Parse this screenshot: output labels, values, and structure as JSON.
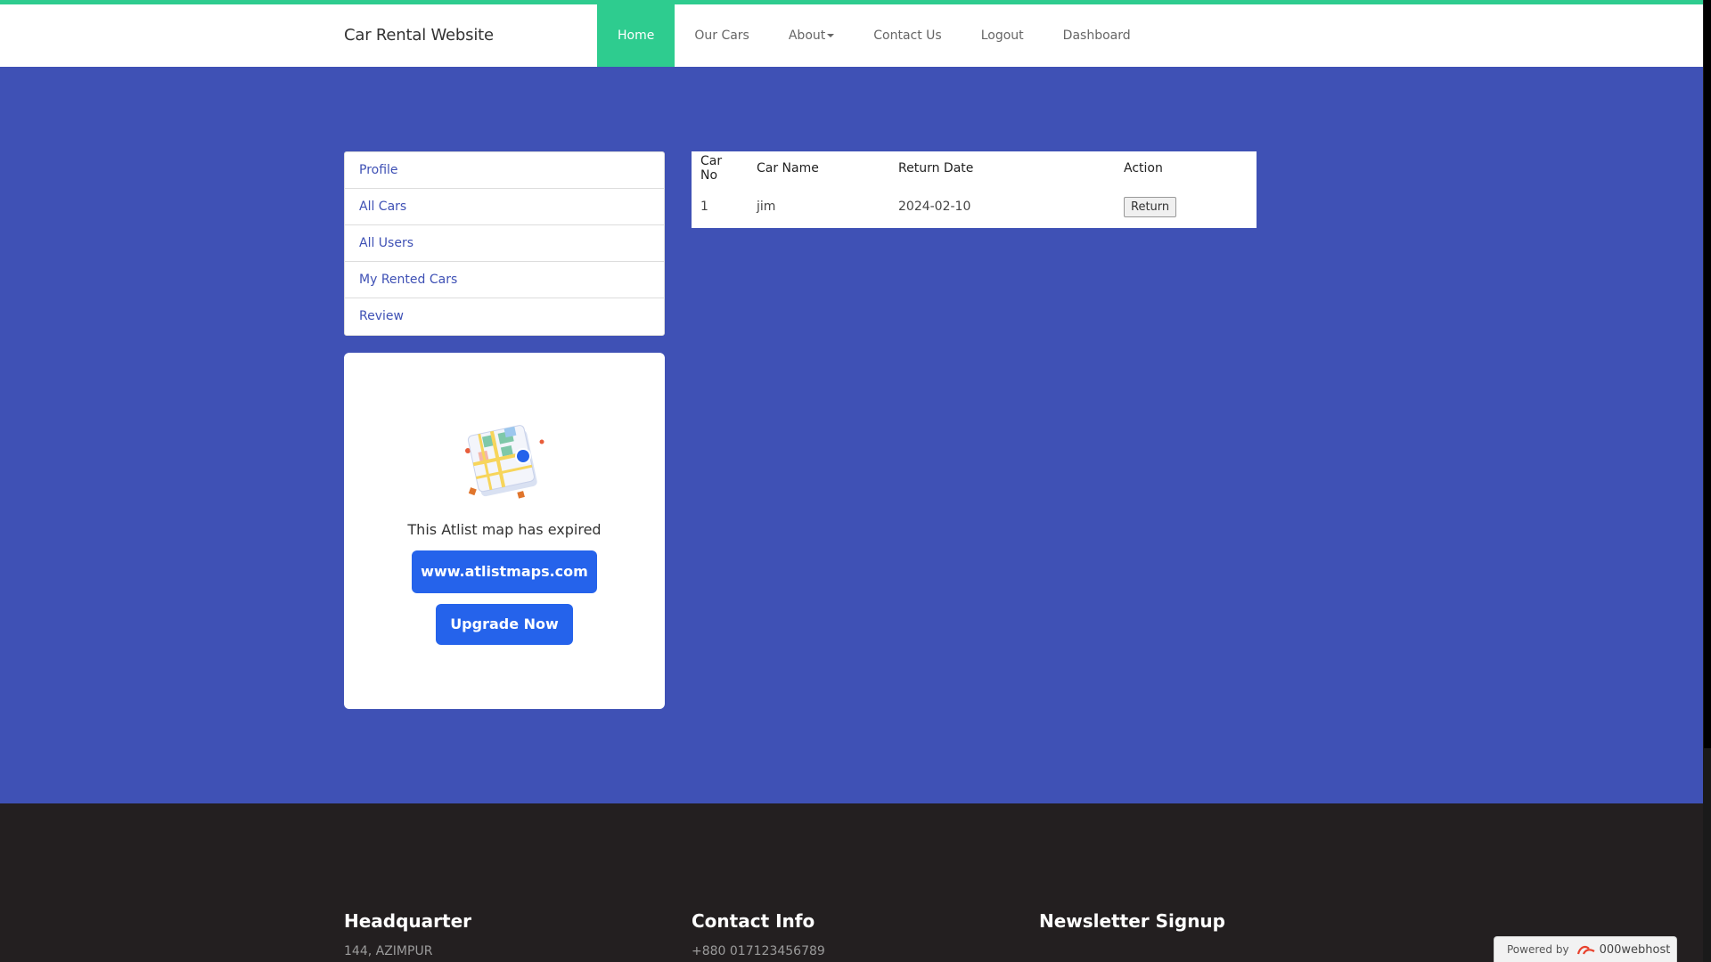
{
  "brand": "Car Rental Website",
  "nav": {
    "home": "Home",
    "our_cars": "Our Cars",
    "about": "About",
    "contact": "Contact Us",
    "logout": "Logout",
    "dashboard": "Dashboard"
  },
  "side_menu": {
    "profile": "Profile",
    "all_cars": "All Cars",
    "all_users": "All Users",
    "my_rented_cars": "My Rented Cars",
    "review": "Review"
  },
  "map_card": {
    "expired_text": "This Atlist map has expired",
    "site_button": "www.atlistmaps.com",
    "upgrade_button": "Upgrade Now"
  },
  "rent_table": {
    "headers": [
      "Car No",
      "Car Name",
      "Return Date",
      "Action"
    ],
    "rows": [
      {
        "car_no": "1",
        "car_name": "jim",
        "return_date": "2024-02-10",
        "action": "Return"
      }
    ]
  },
  "footer": {
    "headquarter_title": "Headquarter",
    "headquarter_text": "144, AZIMPUR",
    "contact_title": "Contact Info",
    "contact_text": "+880 017123456789",
    "newsletter_title": "Newsletter Signup"
  },
  "powered": {
    "label": "Powered by",
    "brand": "000webhost"
  },
  "colors": {
    "accent": "#2ecc8f",
    "page_bg": "#3f51b5",
    "footer_bg": "#231f20",
    "button_blue": "#2563eb"
  }
}
